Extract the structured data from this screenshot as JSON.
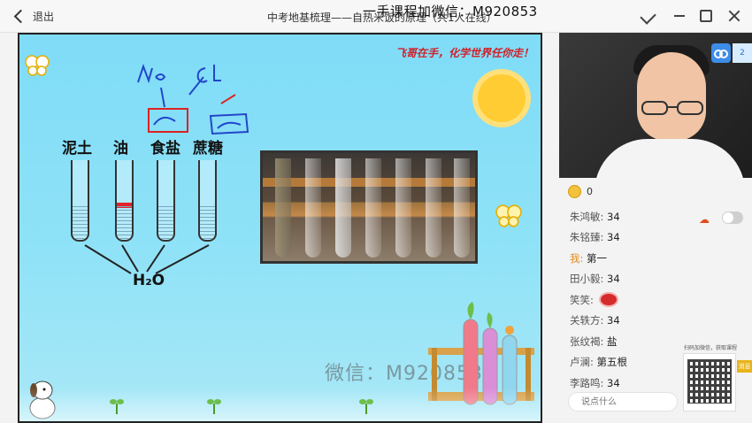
{
  "titlebar": {
    "back_label": "退出",
    "title": "中考地基梳理——自热米饭的原理（共1人在线）",
    "watermark_top": "一手课程加微信：M920853"
  },
  "slide": {
    "slogan": "飞哥在手，化学世界任你走！",
    "labels": [
      "泥土",
      "油",
      "食盐",
      "蔗糖"
    ],
    "h2o": "H₂O",
    "watermark": "微信：M920853"
  },
  "panel": {
    "coin_count": "0",
    "viewer_count": "2",
    "chat": [
      {
        "name": "朱鸿敏:",
        "msg": "34"
      },
      {
        "name": "朱铭臻:",
        "msg": "34"
      },
      {
        "name": "我:",
        "msg": "第一",
        "me": true
      },
      {
        "name": "田小毅:",
        "msg": "34"
      },
      {
        "name": "笑笑:",
        "msg": ""
      },
      {
        "name": "关轶方:",
        "msg": "34"
      },
      {
        "name": "张纹褐:",
        "msg": "盐"
      },
      {
        "name": "卢澜:",
        "msg": "第五根"
      },
      {
        "name": "李路鸣:",
        "msg": "34"
      }
    ],
    "qr_caption": "扫码加微信，获取课程",
    "side_tab": "消息",
    "input_placeholder": "说点什么"
  }
}
